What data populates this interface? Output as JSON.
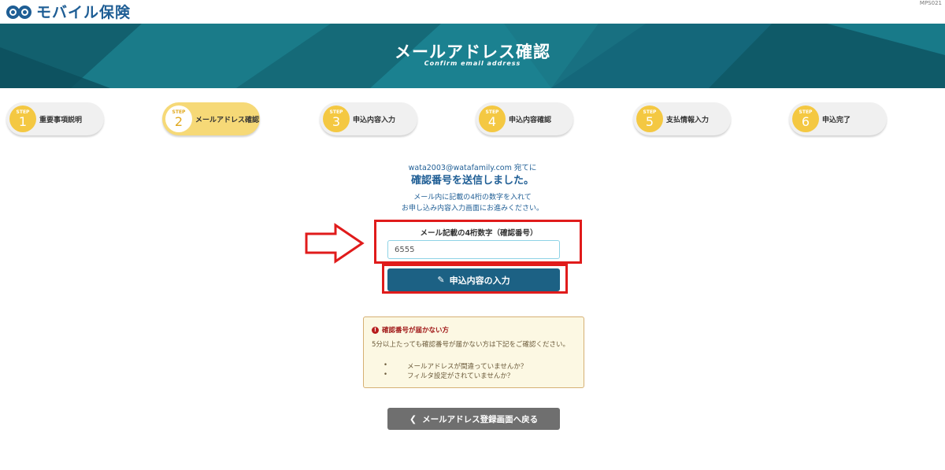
{
  "header": {
    "logo_text": "モバイル保険",
    "page_code": "MPS021"
  },
  "banner": {
    "title": "メールアドレス確認",
    "subtitle": "Confirm email address"
  },
  "steps": [
    {
      "word": "STEP",
      "num": "1",
      "label": "重要事項説明"
    },
    {
      "word": "STEP",
      "num": "2",
      "label": "メールアドレス確認"
    },
    {
      "word": "STEP",
      "num": "3",
      "label": "申込内容入力"
    },
    {
      "word": "STEP",
      "num": "4",
      "label": "申込内容確認"
    },
    {
      "word": "STEP",
      "num": "5",
      "label": "支払情報入力"
    },
    {
      "word": "STEP",
      "num": "6",
      "label": "申込完了"
    }
  ],
  "main": {
    "email_line": "wata2003@watafamily.com 宛てに",
    "sent_title": "確認番号を送信しました。",
    "note_line1": "メール内に記載の4桁の数字を入れて",
    "note_line2": "お申し込み内容入力画面にお進みください。",
    "code_label": "メール記載の4桁数字（確認番号）",
    "code_value": "6555",
    "submit_label": "申込内容の入力"
  },
  "warning": {
    "title": "確認番号が届かない方",
    "body": "5分以上たっても確認番号が届かない方は下記をご確認ください。",
    "items": [
      "メールアドレスが間違っていませんか？",
      "フィルタ設定がされていませんか？"
    ]
  },
  "back_button": {
    "label": "メールアドレス登録画面へ戻る"
  },
  "colors": {
    "brand": "#1f5e95",
    "banner": "#17707f",
    "step_yellow": "#f4c842",
    "submit": "#1c6184",
    "annotation_red": "#e01b1b"
  }
}
